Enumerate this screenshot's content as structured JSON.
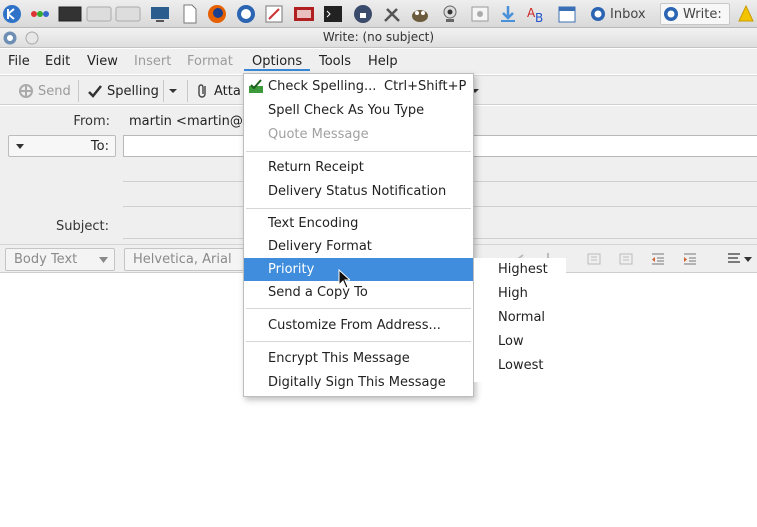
{
  "taskbar": {
    "tasks": [
      {
        "label": "Inbox"
      },
      {
        "label": "Write:"
      }
    ]
  },
  "window": {
    "title": "Write: (no subject)"
  },
  "menubar": {
    "items": [
      {
        "label": "File",
        "state": "normal"
      },
      {
        "label": "Edit",
        "state": "normal"
      },
      {
        "label": "View",
        "state": "normal"
      },
      {
        "label": "Insert",
        "state": "disabled"
      },
      {
        "label": "Format",
        "state": "disabled"
      },
      {
        "label": "Options",
        "state": "open"
      },
      {
        "label": "Tools",
        "state": "normal"
      },
      {
        "label": "Help",
        "state": "normal"
      }
    ]
  },
  "toolbar": {
    "send_label": "Send",
    "spelling_label": "Spelling",
    "attach_label": "Atta"
  },
  "headers": {
    "from_label": "From:",
    "from_value": "martin <martin@l",
    "to_label": "To:",
    "subject_label": "Subject:"
  },
  "formatbar": {
    "paragraph_style": "Body Text",
    "font_family": "Helvetica, Arial"
  },
  "options_menu": {
    "items": [
      {
        "label": "Check Spelling...",
        "shortcut": "Ctrl+Shift+P"
      },
      {
        "label": "Spell Check As You Type"
      },
      {
        "label": "Quote Message"
      },
      {
        "label": "Return Receipt"
      },
      {
        "label": "Delivery Status Notification"
      },
      {
        "label": "Text Encoding"
      },
      {
        "label": "Delivery Format"
      },
      {
        "label": "Priority"
      },
      {
        "label": "Send a Copy To"
      },
      {
        "label": "Customize From Address..."
      },
      {
        "label": "Encrypt This Message"
      },
      {
        "label": "Digitally Sign This Message"
      }
    ]
  },
  "priority_menu": {
    "items": [
      {
        "label": "Highest"
      },
      {
        "label": "High"
      },
      {
        "label": "Normal"
      },
      {
        "label": "Low"
      },
      {
        "label": "Lowest"
      }
    ]
  },
  "colors": {
    "highlight": "#3f8ddc",
    "menu_underline": "#3a87d8",
    "chrome": "#efefef"
  }
}
